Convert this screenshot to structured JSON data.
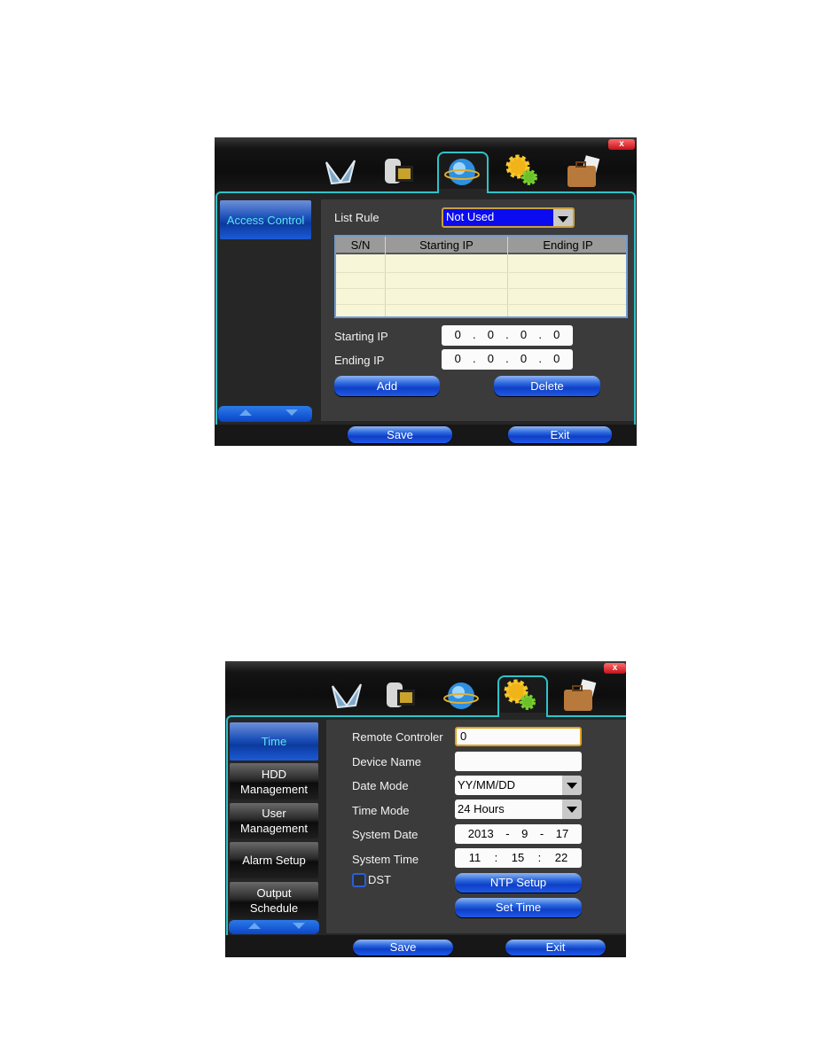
{
  "panel1": {
    "close_label": "x",
    "tabs": [
      {
        "icon": "film-reel-icon"
      },
      {
        "icon": "camcorder-icon"
      },
      {
        "icon": "network-globe-icon",
        "selected": true
      },
      {
        "icon": "gears-icon"
      },
      {
        "icon": "briefcase-icon"
      }
    ],
    "sidebar": [
      {
        "label": "Access Control",
        "selected": true
      }
    ],
    "list_rule_label": "List Rule",
    "list_rule_value": "Not Used",
    "table": {
      "headers": [
        "S/N",
        "Starting IP",
        "Ending IP"
      ],
      "rows": []
    },
    "starting_ip_label": "Starting IP",
    "starting_ip": [
      "0",
      "0",
      "0",
      "0"
    ],
    "ending_ip_label": "Ending IP",
    "ending_ip": [
      "0",
      "0",
      "0",
      "0"
    ],
    "add_label": "Add",
    "delete_label": "Delete",
    "save_label": "Save",
    "exit_label": "Exit"
  },
  "panel2": {
    "close_label": "x",
    "tabs": [
      {
        "icon": "film-reel-icon"
      },
      {
        "icon": "camcorder-icon"
      },
      {
        "icon": "network-globe-icon"
      },
      {
        "icon": "gears-icon",
        "selected": true
      },
      {
        "icon": "briefcase-icon"
      }
    ],
    "sidebar": [
      {
        "line1": "Time",
        "line2": "",
        "selected": true
      },
      {
        "line1": "HDD",
        "line2": "Management"
      },
      {
        "line1": "User",
        "line2": "Management"
      },
      {
        "line1": "Alarm Setup",
        "line2": ""
      },
      {
        "line1": "Output",
        "line2": "Schedule"
      }
    ],
    "fields": {
      "remote_controler_label": "Remote Controler",
      "remote_controler_value": "0",
      "device_name_label": "Device Name",
      "device_name_value": "",
      "date_mode_label": "Date Mode",
      "date_mode_value": "YY/MM/DD",
      "time_mode_label": "Time Mode",
      "time_mode_value": "24 Hours",
      "system_date_label": "System Date",
      "system_date": [
        "2013",
        "-",
        "9",
        "-",
        "17"
      ],
      "system_time_label": "System Time",
      "system_time": [
        "11",
        ":",
        "15",
        ":",
        "22"
      ],
      "dst_label": "DST",
      "dst_checked": false
    },
    "ntp_label": "NTP Setup",
    "set_time_label": "Set Time",
    "save_label": "Save",
    "exit_label": "Exit"
  },
  "colors": {
    "accent_border": "#2fc3c8",
    "button_blue": "#1f5ae8",
    "selected_text": "#5ce3f0",
    "dropdown_blue": "#0b0bf0"
  }
}
